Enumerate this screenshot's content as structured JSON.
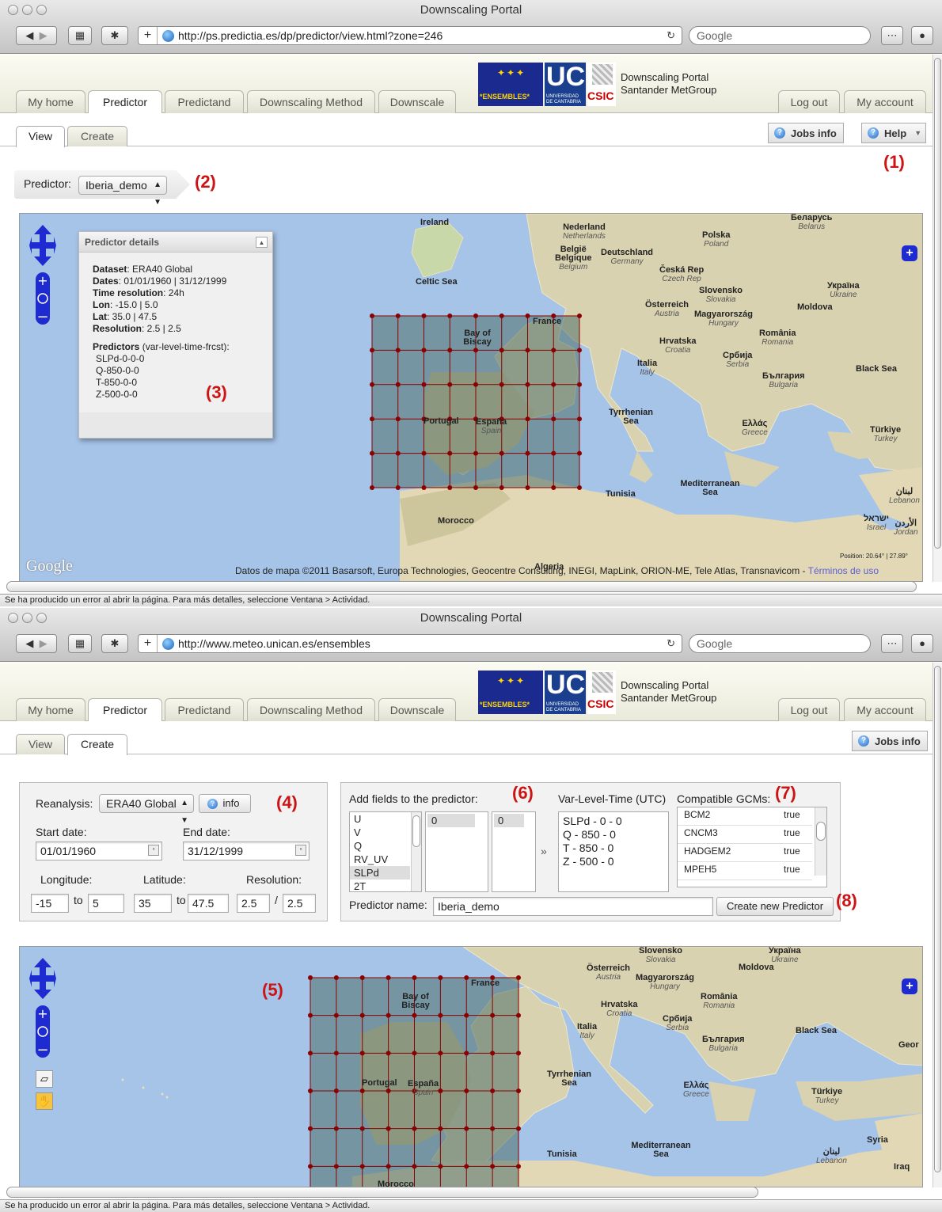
{
  "window1": {
    "title": "Downscaling Portal",
    "url": "http://ps.predictia.es/dp/predictor/view.html?zone=246",
    "search_placeholder": "Google",
    "main_tabs": [
      "My home",
      "Predictor",
      "Predictand",
      "Downscaling Method",
      "Downscale"
    ],
    "right_tabs": [
      "Log out",
      "My account"
    ],
    "logo": {
      "ensembles": "*ENSEMBLES*",
      "uc": "UC",
      "uc_sub": "UNIVERSIDAD DE CANTABRIA",
      "csic": "CSIC",
      "portal_line1": "Downscaling Portal",
      "portal_line2": "Santander MetGroup"
    },
    "sub_tabs": [
      "View",
      "Create"
    ],
    "jobs_info": "Jobs info",
    "help": "Help",
    "predictor_label": "Predictor:",
    "predictor_value": "Iberia_demo",
    "callouts": {
      "c1": "(1)",
      "c2": "(2)",
      "c3": "(3)"
    },
    "details": {
      "title": "Predictor details",
      "rows": [
        {
          "k": "Dataset",
          "v": ": ERA40 Global"
        },
        {
          "k": "Dates",
          "v": ": 01/01/1960 | 31/12/1999"
        },
        {
          "k": "Time resolution",
          "v": ": 24h"
        },
        {
          "k": "Lon",
          "v": ": -15.0 | 5.0"
        },
        {
          "k": "Lat",
          "v": ": 35.0 | 47.5"
        },
        {
          "k": "Resolution",
          "v": ": 2.5 | 2.5"
        }
      ],
      "predictors_k": "Predictors",
      "predictors_v": " (var-level-time-frcst):",
      "predictor_list": [
        "SLPd-0-0-0",
        "Q-850-0-0",
        "T-850-0-0",
        "Z-500-0-0"
      ]
    },
    "map_labels": {
      "ireland": "Ireland",
      "nederland": "Nederland",
      "nederland_i": "Netherlands",
      "belgie": "België",
      "belgie2": "Belgique",
      "belgie_i": "Belgium",
      "deutschland": "Deutschland",
      "deutschland_i": "Germany",
      "polska": "Polska",
      "polska_i": "Poland",
      "belarus": "Беларусь",
      "belarus_i": "Belarus",
      "celtic": "Celtic Sea",
      "ceska": "Česká Rep",
      "ceska_i": "Czech Rep",
      "slovensko": "Slovensko",
      "slovensko_i": "Slovakia",
      "ukraina": "Україна",
      "ukraina_i": "Ukraine",
      "osterreich": "Österreich",
      "osterreich_i": "Austria",
      "magyar": "Magyarország",
      "magyar_i": "Hungary",
      "moldova": "Moldova",
      "france": "France",
      "biscay": "Bay of Biscay",
      "hrvatska": "Hrvatska",
      "hrvatska_i": "Croatia",
      "romania": "România",
      "romania_i": "Romania",
      "srbija": "Србија",
      "srbija_i": "Serbia",
      "italia": "Italia",
      "italia_i": "Italy",
      "bulgaria": "България",
      "bulgaria_i": "Bulgaria",
      "blacksea": "Black Sea",
      "portugal": "Portugal",
      "espana": "España",
      "espana_i": "Spain",
      "tyrrhenian": "Tyrrhenian Sea",
      "ellas": "Ελλάς",
      "ellas_i": "Greece",
      "turkiye": "Türkiye",
      "turkiye_i": "Turkey",
      "med": "Mediterranean Sea",
      "tunisia": "Tunisia",
      "morocco": "Morocco",
      "lebanon": "لبنان",
      "lebanon_i": "Lebanon",
      "israel": "ישראל",
      "israel_i": "Israel",
      "jordan": "الأردن",
      "jordan_i": "Jordan",
      "algeria": "Algeria"
    },
    "google": "Google",
    "attribution": "Datos de mapa ©2011 Basarsoft, Europa Technologies, Geocentre Consulting, INEGI, MapLink, ORION-ME, Tele Atlas, Transnavicom -",
    "terms": "Términos de uso",
    "position": "Position: 20.64° | 27.89°",
    "status": "Se ha producido un error al abrir la página. Para más detalles, seleccione Ventana > Actividad."
  },
  "window2": {
    "title": "Downscaling Portal",
    "url": "http://www.meteo.unican.es/ensembles",
    "search_placeholder": "Google",
    "sub_tabs": [
      "View",
      "Create"
    ],
    "jobs_info": "Jobs info",
    "callouts": {
      "c4": "(4)",
      "c5": "(5)",
      "c6": "(6)",
      "c7": "(7)",
      "c8": "(8)"
    },
    "form": {
      "reanalysis_label": "Reanalysis:",
      "reanalysis_value": "ERA40 Global",
      "info": "info",
      "start_label": "Start date:",
      "start_value": "01/01/1960",
      "end_label": "End date:",
      "end_value": "31/12/1999",
      "lon_label": "Longitude:",
      "lat_label": "Latitude:",
      "res_label": "Resolution:",
      "lon_from": "-15",
      "lon_to": "5",
      "lat_from": "35",
      "lat_to": "47.5",
      "res_a": "2.5",
      "res_b": "2.5",
      "to": "to",
      "slash": "/"
    },
    "fields": {
      "add_label": "Add fields to the predictor:",
      "vars": [
        "U",
        "V",
        "Q",
        "RV_UV",
        "SLPd",
        "2T"
      ],
      "selected_var": "SLPd",
      "level_value": "0",
      "time_value": "0",
      "arrow": "»",
      "vlt_label": "Var-Level-Time (UTC)",
      "vlt_items": [
        "SLPd - 0 - 0",
        "Q - 850 - 0",
        "T - 850 - 0",
        "Z - 500 - 0"
      ],
      "gcm_label": "Compatible GCMs:",
      "gcms": [
        {
          "name": "BCM2",
          "ok": "true"
        },
        {
          "name": "CNCM3",
          "ok": "true"
        },
        {
          "name": "HADGEM2",
          "ok": "true"
        },
        {
          "name": "MPEH5",
          "ok": "true"
        }
      ],
      "name_label": "Predictor name:",
      "name_value": "Iberia_demo",
      "create": "Create new Predictor"
    },
    "map_labels": {
      "slovensko": "Slovensko",
      "slovensko_i": "Slovakia",
      "ukraina": "Україна",
      "ukraina_i": "Ukraine",
      "osterreich": "Österreich",
      "osterreich_i": "Austria",
      "magyar": "Magyarország",
      "magyar_i": "Hungary",
      "moldova": "Moldova",
      "france": "France",
      "biscay": "Bay of Biscay",
      "hrvatska": "Hrvatska",
      "hrvatska_i": "Croatia",
      "romania": "România",
      "romania_i": "Romania",
      "srbija": "Србија",
      "srbija_i": "Serbia",
      "italia": "Italia",
      "italia_i": "Italy",
      "bulgaria": "България",
      "bulgaria_i": "Bulgaria",
      "blacksea": "Black Sea",
      "geor": "Geor",
      "portugal": "Portugal",
      "espana": "España",
      "espana_i": "Spain",
      "tyrrhenian": "Tyrrhenian Sea",
      "ellas": "Ελλάς",
      "ellas_i": "Greece",
      "turkiye": "Türkiye",
      "turkiye_i": "Turkey",
      "syria": "Syria",
      "lebanon": "لبنان",
      "lebanon_i": "Lebanon",
      "iraq": "Iraq",
      "med": "Mediterranean Sea",
      "tunisia": "Tunisia",
      "morocco": "Morocco"
    },
    "status": "Se ha producido un error al abrir la página. Para más detalles, seleccione Ventana > Actividad."
  },
  "colors": {
    "accent_red": "#cc1414",
    "nav_blue": "#1d2bd0",
    "grid_point": "#8b0000"
  }
}
